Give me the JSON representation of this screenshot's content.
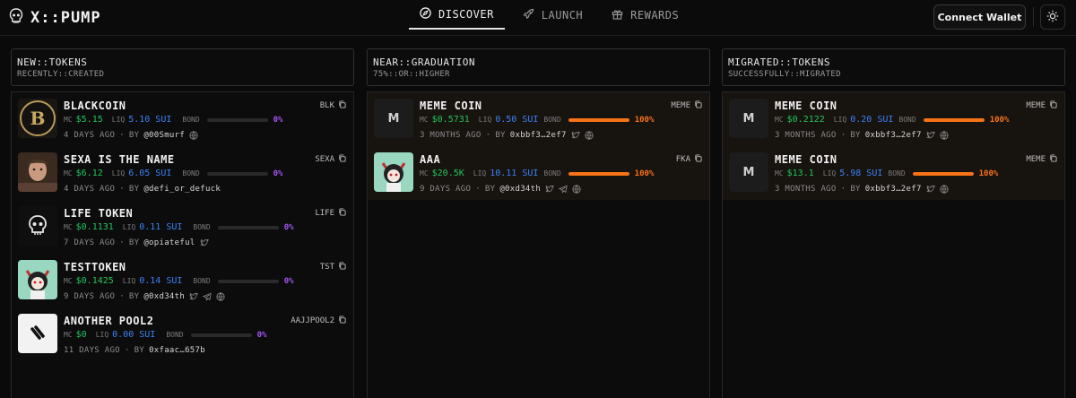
{
  "header": {
    "logo_text": "X::PUMP",
    "nav": [
      {
        "label": "DISCOVER",
        "icon": "compass-icon",
        "active": true
      },
      {
        "label": "LAUNCH",
        "icon": "rocket-icon",
        "active": false
      },
      {
        "label": "REWARDS",
        "icon": "gift-icon",
        "active": false
      }
    ],
    "connect_label": "Connect Wallet",
    "theme_icon": "sun-icon"
  },
  "labels": {
    "mc": "MC",
    "liq": "LIQ",
    "bond": "BOND",
    "by": "BY"
  },
  "colors": {
    "mc": "#22c55e",
    "liq": "#3b82f6",
    "bond_fill": "#f97316",
    "bond_zero": "#a855f7"
  },
  "columns": [
    {
      "title": "NEW::TOKENS",
      "subtitle": "RECENTLY::CREATED",
      "tokens": [
        {
          "name": "BLACKCOIN",
          "ticker": "BLK",
          "mc": "$5.15",
          "liq": "5.10 SUI",
          "bond_pct": "0%",
          "bond_progress": 0,
          "age": "4 DAYS AGO",
          "creator": "@00Smurf",
          "links": [
            "globe-icon"
          ]
        },
        {
          "name": "SEXA IS THE NAME",
          "ticker": "SEXA",
          "mc": "$6.12",
          "liq": "6.05 SUI",
          "bond_pct": "0%",
          "bond_progress": 0,
          "age": "4 DAYS AGO",
          "creator": "@defi_or_defuck",
          "links": []
        },
        {
          "name": "LIFE TOKEN",
          "ticker": "LIFE",
          "mc": "$0.1131",
          "liq": "0.11 SUI",
          "bond_pct": "0%",
          "bond_progress": 0,
          "age": "7 DAYS AGO",
          "creator": "@opiateful",
          "links": [
            "twitter-icon"
          ]
        },
        {
          "name": "TESTTOKEN",
          "ticker": "TST",
          "mc": "$0.1425",
          "liq": "0.14 SUI",
          "bond_pct": "0%",
          "bond_progress": 0,
          "age": "9 DAYS AGO",
          "creator": "@0xd34th",
          "links": [
            "twitter-icon",
            "telegram-icon",
            "globe-icon"
          ]
        },
        {
          "name": "ANOTHER POOL2",
          "ticker": "AAJJPOOL2",
          "mc": "$0",
          "liq": "0.00 SUI",
          "bond_pct": "0%",
          "bond_progress": 0,
          "age": "11 DAYS AGO",
          "creator": "0xfaac…657b",
          "links": []
        }
      ]
    },
    {
      "title": "NEAR::GRADUATION",
      "subtitle": "75%::OR::HIGHER",
      "tokens": [
        {
          "name": "MEME COIN",
          "ticker": "MEME",
          "mc": "$0.5731",
          "liq": "0.50 SUI",
          "bond_pct": "100%",
          "bond_progress": 1,
          "age": "3 MONTHS AGO",
          "creator": "0xbbf3…2ef7",
          "thumb_letter": "M",
          "links": [
            "twitter-icon",
            "globe-icon"
          ]
        },
        {
          "name": "AAA",
          "ticker": "FKA",
          "mc": "$20.5K",
          "liq": "10.11 SUI",
          "bond_pct": "100%",
          "bond_progress": 1,
          "age": "9 DAYS AGO",
          "creator": "@0xd34th",
          "links": [
            "twitter-icon",
            "telegram-icon",
            "globe-icon"
          ]
        }
      ]
    },
    {
      "title": "MIGRATED::TOKENS",
      "subtitle": "SUCCESSFULLY::MIGRATED",
      "tokens": [
        {
          "name": "MEME COIN",
          "ticker": "MEME",
          "mc": "$0.2122",
          "liq": "0.20 SUI",
          "bond_pct": "100%",
          "bond_progress": 1,
          "age": "3 MONTHS AGO",
          "creator": "0xbbf3…2ef7",
          "thumb_letter": "M",
          "links": [
            "twitter-icon",
            "globe-icon"
          ]
        },
        {
          "name": "MEME COIN",
          "ticker": "MEME",
          "mc": "$13.1",
          "liq": "5.98 SUI",
          "bond_pct": "100%",
          "bond_progress": 1,
          "age": "3 MONTHS AGO",
          "creator": "0xbbf3…2ef7",
          "thumb_letter": "M",
          "links": [
            "twitter-icon",
            "globe-icon"
          ]
        }
      ]
    }
  ]
}
